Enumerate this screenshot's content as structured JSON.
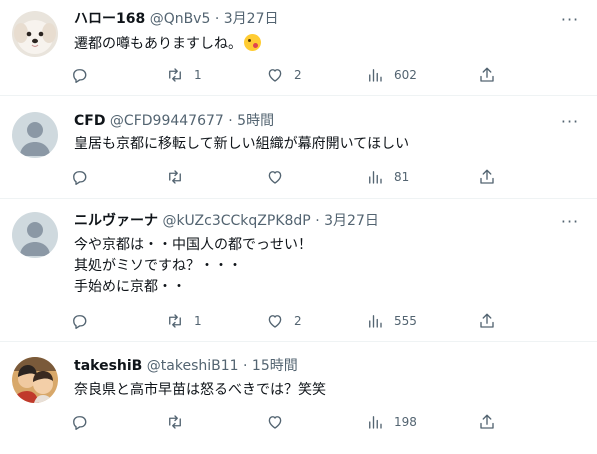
{
  "tweets": [
    {
      "name": "ハロー168",
      "handle": "@QnBv5",
      "time": "3月27日",
      "text": "遷都の噂もありますしね。",
      "emoji": "winking-tongue-emoji",
      "replies": "",
      "retweets": "1",
      "likes": "2",
      "views": "602"
    },
    {
      "name": "CFD",
      "handle": "@CFD99447677",
      "time": "5時間",
      "text": "皇居も京都に移転して新しい組織が幕府開いてほしい",
      "replies": "",
      "retweets": "",
      "likes": "",
      "views": "81"
    },
    {
      "name": "ニルヴァーナ",
      "handle": "@kUZc3CCkqZPK8dP",
      "time": "3月27日",
      "text": "今や京都は・・中国人の都でっせい！\n其処がミソですね？・・・\n手始めに京都・・",
      "replies": "",
      "retweets": "1",
      "likes": "2",
      "views": "555"
    },
    {
      "name": "takeshiB",
      "handle": "@takeshiB11",
      "time": "15時間",
      "text": "奈良県と高市早苗は怒るべきでは？笑笑",
      "replies": "",
      "retweets": "",
      "likes": "",
      "views": "198"
    }
  ],
  "separator": "·",
  "more_glyph": "···",
  "colors": {
    "text": "#0f1419",
    "secondary": "#536471",
    "divider": "#eff3f4",
    "default_avatar_bg": "#cfd9de"
  }
}
